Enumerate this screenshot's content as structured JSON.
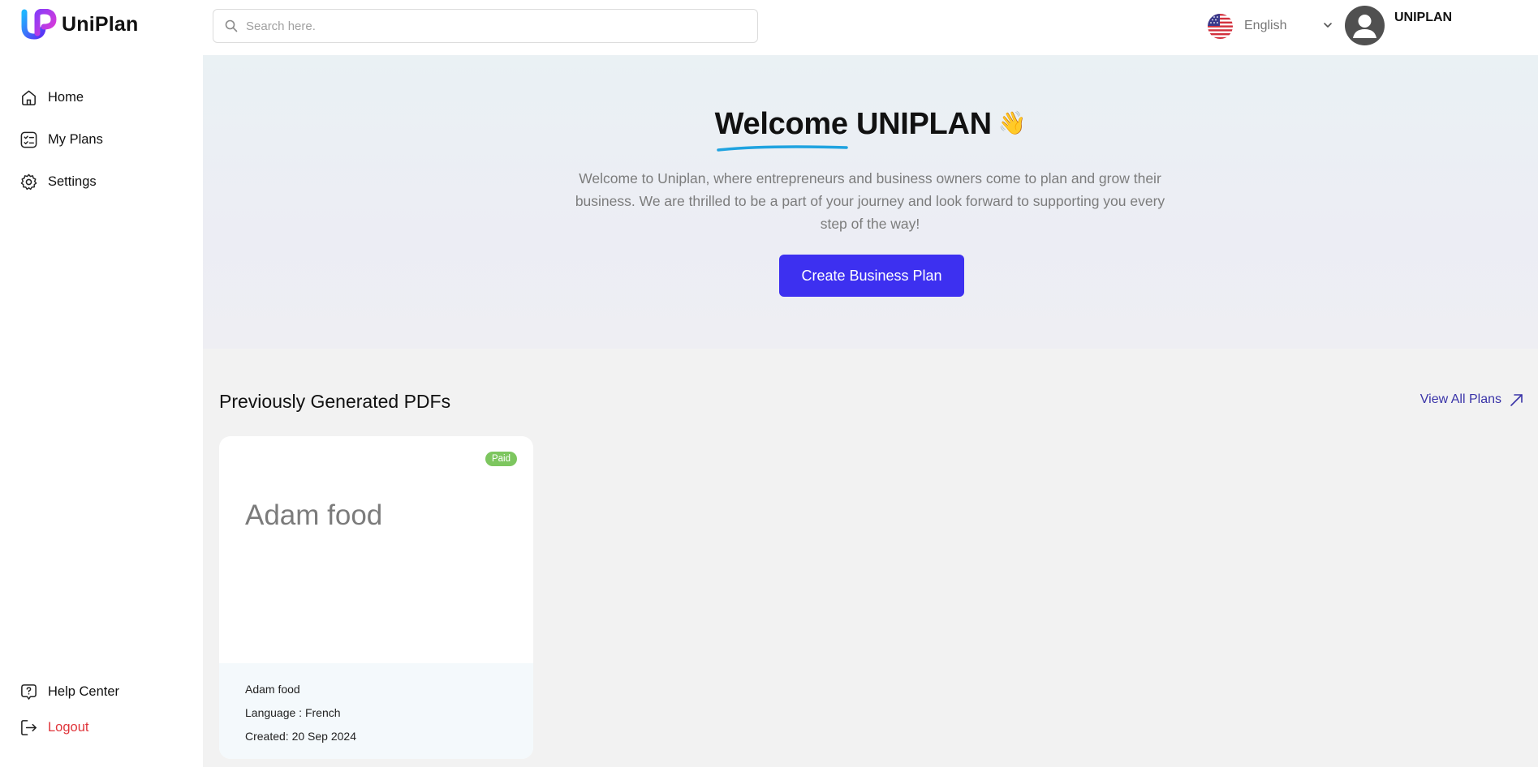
{
  "app": {
    "name": "UniPlan"
  },
  "search": {
    "placeholder": "Search here."
  },
  "language": {
    "selected": "English"
  },
  "user": {
    "name": "UNIPLAN"
  },
  "sidebar": {
    "items": [
      {
        "label": "Home",
        "icon": "home-icon"
      },
      {
        "label": "My Plans",
        "icon": "checklist-icon"
      },
      {
        "label": "Settings",
        "icon": "gear-icon"
      }
    ],
    "bottom": [
      {
        "label": "Help Center",
        "icon": "help-icon"
      },
      {
        "label": "Logout",
        "icon": "logout-icon"
      }
    ]
  },
  "hero": {
    "title_word": "Welcome",
    "title_name": "UNIPLAN",
    "emoji": "👋",
    "description": "Welcome to Uniplan, where entrepreneurs and business owners come to plan and grow their business. We are thrilled to be a part of your journey and look forward to supporting you every step of the way!",
    "cta_label": "Create Business Plan"
  },
  "pdfs": {
    "section_title": "Previously Generated PDFs",
    "view_all_label": "View All Plans",
    "items": [
      {
        "title": "Adam food",
        "badge": "Paid",
        "name": "Adam food",
        "language": "Language : French",
        "created": "Created: 20 Sep 2024"
      }
    ]
  },
  "colors": {
    "accent": "#3d30f0",
    "paid_badge": "#7dc65f",
    "logout": "#e0353b",
    "link": "#3a34a8"
  }
}
